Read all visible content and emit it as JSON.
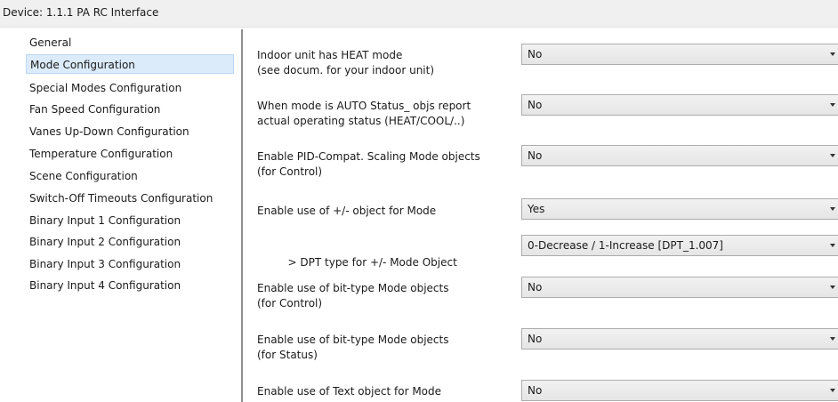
{
  "window": {
    "title": "Device: 1.1.1  PA RC Interface"
  },
  "sidebar": {
    "items": [
      {
        "label": "General"
      },
      {
        "label": "Mode Configuration",
        "selected": true
      },
      {
        "label": "Special Modes Configuration"
      },
      {
        "label": "Fan Speed Configuration"
      },
      {
        "label": "Vanes Up-Down Configuration"
      },
      {
        "label": "Temperature Configuration"
      },
      {
        "label": "Scene Configuration"
      },
      {
        "label": "Switch-Off Timeouts Configuration"
      },
      {
        "label": "Binary Input 1 Configuration"
      },
      {
        "label": "Binary Input 2 Configuration"
      },
      {
        "label": "Binary Input 3 Configuration"
      },
      {
        "label": "Binary Input 4 Configuration"
      }
    ]
  },
  "params": [
    {
      "line1": "Indoor unit has HEAT mode",
      "line2": "(see docum. for your indoor unit)",
      "value": "No"
    },
    {
      "line1": "When mode is AUTO Status_ objs report",
      "line2": "actual operating status (HEAT/COOL/..)",
      "value": "No"
    },
    {
      "line1": "Enable PID-Compat. Scaling Mode objects",
      "line2": "(for Control)",
      "value": "No"
    },
    {
      "line1": "Enable use of +/- object for Mode",
      "line2": "",
      "value": "Yes"
    },
    {
      "line1": "  > DPT type for +/- Mode Object",
      "line2": "",
      "value": "0-Decrease / 1-Increase [DPT_1.007]"
    },
    {
      "line1": "Enable use of bit-type Mode objects",
      "line2": "(for Control)",
      "value": "No"
    },
    {
      "line1": "Enable use of bit-type Mode objects",
      "line2": "(for Status)",
      "value": "No"
    },
    {
      "line1": "Enable use of Text object for Mode",
      "line2": "",
      "value": "No"
    }
  ]
}
